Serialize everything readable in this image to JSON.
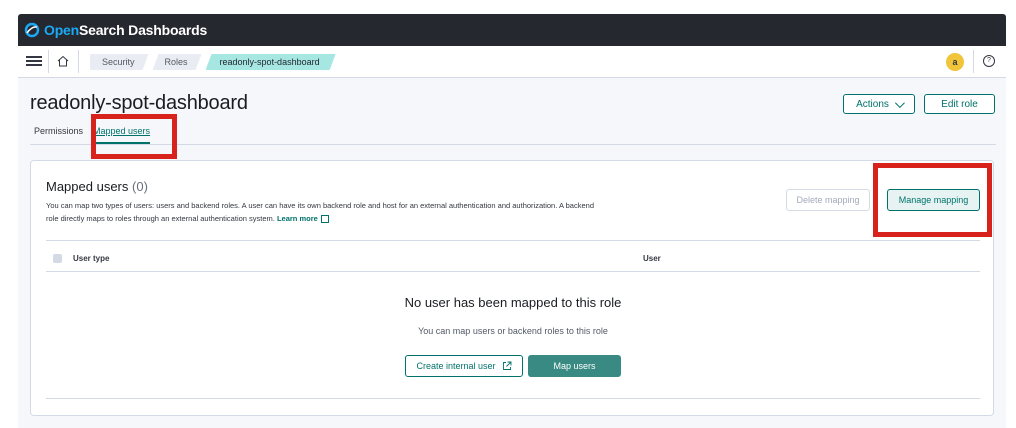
{
  "app": {
    "brand_open": "Open",
    "brand_rest": "Search Dashboards"
  },
  "breadcrumbs": [
    "Security",
    "Roles",
    "readonly-spot-dashboard"
  ],
  "user": {
    "avatar_initial": "a"
  },
  "icons": {
    "help": "help-icon",
    "menu": "hamburger-menu-icon",
    "home": "home-icon",
    "logo": "opensearch-logo-icon",
    "external": "external-link-icon",
    "chevron": "chevron-down-icon"
  },
  "page": {
    "title": "readonly-spot-dashboard",
    "actions_label": "Actions",
    "edit_label": "Edit role",
    "tabs": [
      "Permissions",
      "Mapped users"
    ]
  },
  "panel": {
    "title": "Mapped users",
    "count": "(0)",
    "description": "You can map two types of users: users and backend roles. A user can have its own backend role and host for an external authentication and authorization. A backend role directly maps to roles through an external authentication system.",
    "learn_more": "Learn more",
    "delete_label": "Delete mapping",
    "manage_label": "Manage mapping",
    "columns": [
      "User type",
      "User"
    ],
    "empty_title": "No user has been mapped to this role",
    "empty_subtitle": "You can map users or backend roles to this role",
    "create_label": "Create internal user",
    "map_label": "Map users"
  },
  "colors": {
    "accent": "#00726b",
    "highlight": "#d8231c",
    "header": "#25282f",
    "primary_fill": "#388a82"
  }
}
